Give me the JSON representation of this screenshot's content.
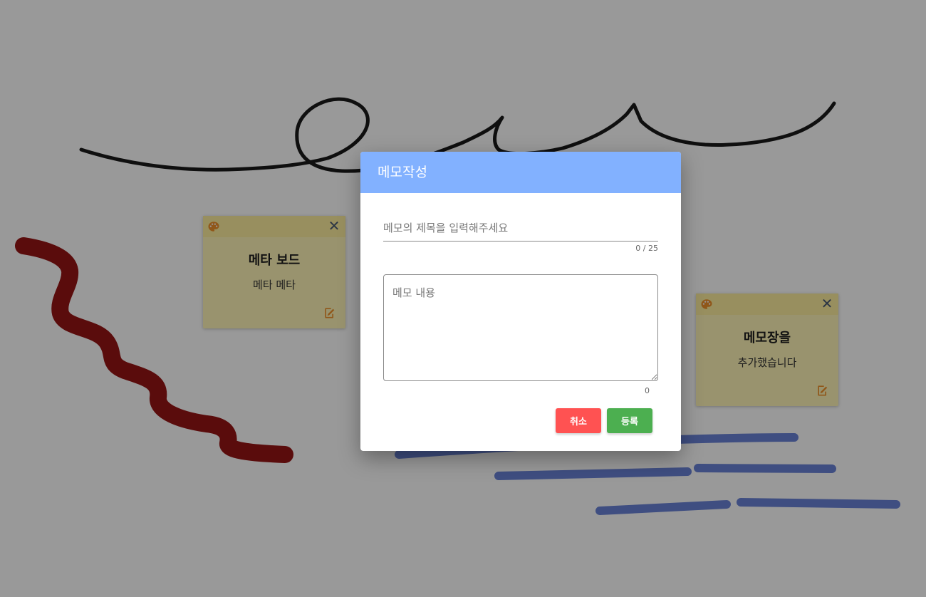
{
  "dialog": {
    "title": "메모작성",
    "title_placeholder": "메모의 제목을 입력해주세요",
    "title_value": "",
    "title_counter": "0 / 25",
    "content_placeholder": "메모 내용",
    "content_value": "",
    "content_counter": "0",
    "cancel_label": "취소",
    "submit_label": "등록"
  },
  "memos": [
    {
      "title": "메타 보드",
      "body": "메타 메타"
    },
    {
      "title": "메모장을",
      "body": "추가했습니다"
    }
  ],
  "icons": {
    "palette": "palette-icon",
    "close": "close-icon",
    "edit": "edit-icon"
  },
  "colors": {
    "dialog_header": "#82b1ff",
    "cancel_button": "#ff5252",
    "submit_button": "#4caf50",
    "memo_background": "#fff5b8",
    "stroke_black": "#1a1a1a",
    "stroke_red": "#961414",
    "stroke_blue": "#6a82d8",
    "icon_accent": "#f0922a"
  }
}
